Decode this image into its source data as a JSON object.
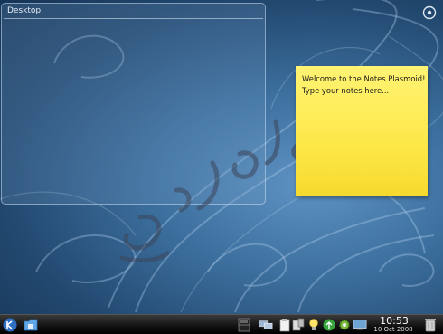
{
  "desktop": {
    "folderview_title": "Desktop"
  },
  "note": {
    "line1": "Welcome to the Notes Plasmoid!",
    "line2": "Type your notes here..."
  },
  "watermark": {
    "text": "سوقی عوز"
  },
  "panel": {
    "clock_time": "10:53",
    "clock_date": "10 Oct 2008",
    "icons": [
      "kde-menu-icon",
      "folder-icon",
      "pager-icon",
      "network-icon",
      "clipboard-icon",
      "device-notifier-icon",
      "battery-icon",
      "lightbulb-icon",
      "update-icon",
      "settings-icon",
      "display-icon",
      "trash-icon"
    ]
  },
  "colors": {
    "note": "#fde849",
    "background": "#3d709f",
    "panel": "#111111"
  }
}
